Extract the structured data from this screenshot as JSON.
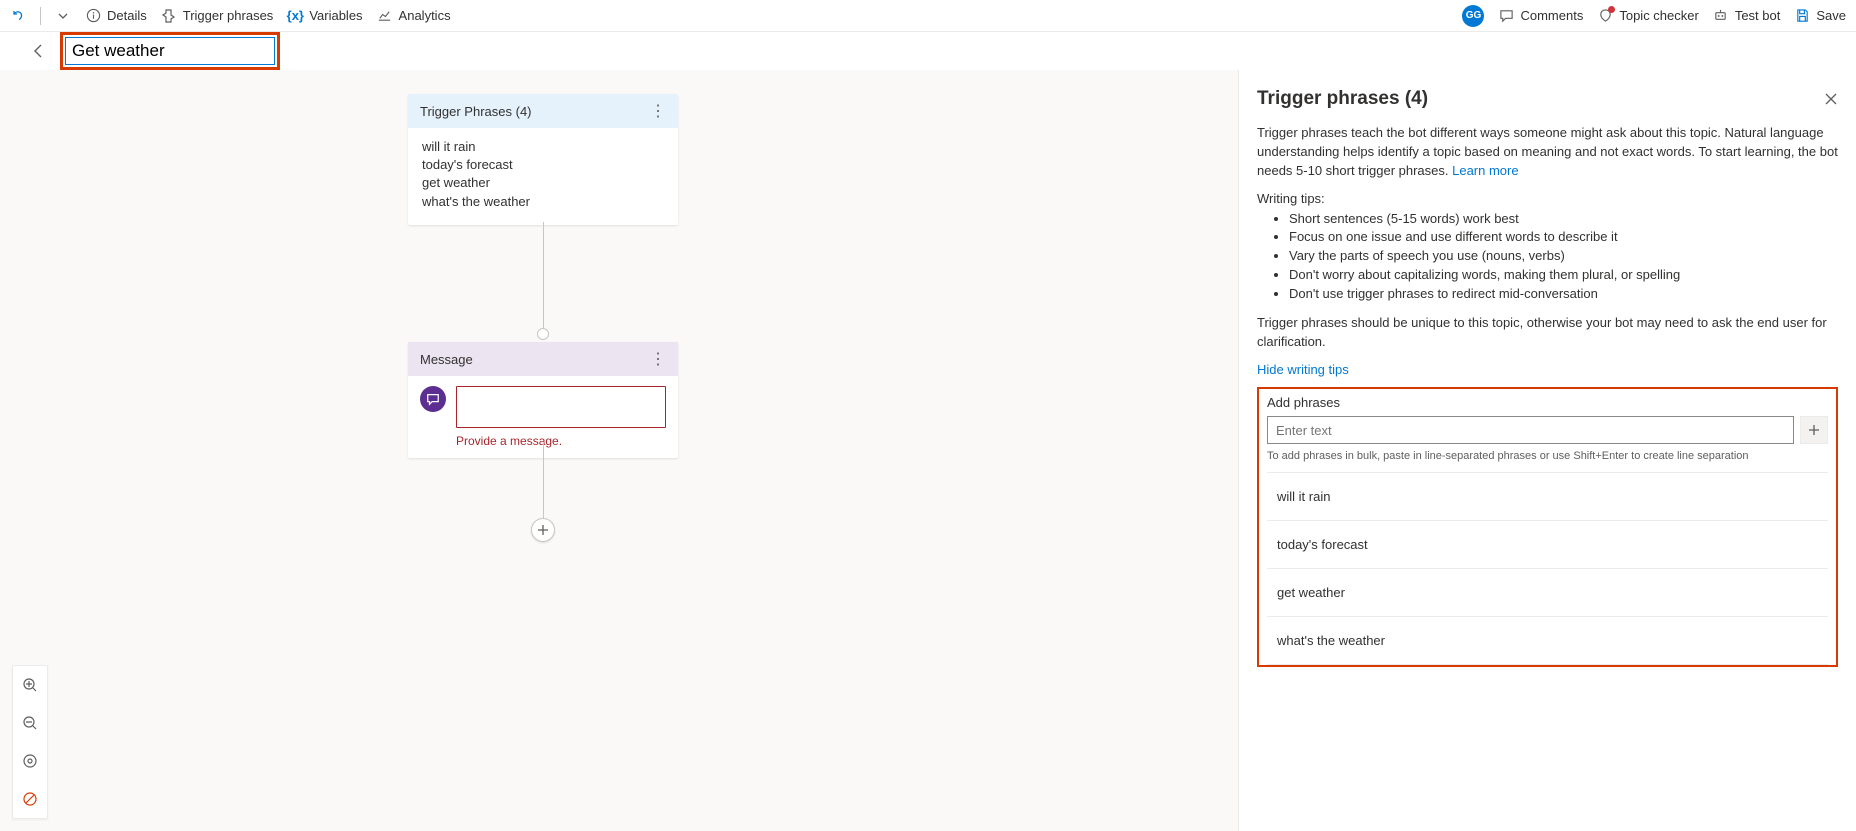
{
  "toolbar": {
    "details": "Details",
    "trigger_phrases": "Trigger phrases",
    "variables": "Variables",
    "analytics": "Analytics",
    "comments": "Comments",
    "topic_checker": "Topic checker",
    "test_bot": "Test bot",
    "save": "Save",
    "avatar_initials": "GG"
  },
  "title_input_value": "Get weather",
  "canvas": {
    "trigger": {
      "header": "Trigger Phrases (4)",
      "phrases": [
        "will it rain",
        "today's forecast",
        "get weather",
        "what's the weather"
      ]
    },
    "message": {
      "header": "Message",
      "error": "Provide a message."
    }
  },
  "panel": {
    "title": "Trigger phrases (4)",
    "intro": "Trigger phrases teach the bot different ways someone might ask about this topic. Natural language understanding helps identify a topic based on meaning and not exact words. To start learning, the bot needs 5-10 short trigger phrases. ",
    "learn_more": "Learn more",
    "tips_title": "Writing tips:",
    "tips": [
      "Short sentences (5-15 words) work best",
      "Focus on one issue and use different words to describe it",
      "Vary the parts of speech you use (nouns, verbs)",
      "Don't worry about capitalizing words, making them plural, or spelling",
      "Don't use trigger phrases to redirect mid-conversation"
    ],
    "unique_para": "Trigger phrases should be unique to this topic, otherwise your bot may need to ask the end user for clarification.",
    "hide_tips": "Hide writing tips",
    "add_phrases_label": "Add phrases",
    "add_placeholder": "Enter text",
    "add_hint": "To add phrases in bulk, paste in line-separated phrases or use Shift+Enter to create line separation",
    "phrases": [
      "will it rain",
      "today's forecast",
      "get weather",
      "what's the weather"
    ]
  }
}
